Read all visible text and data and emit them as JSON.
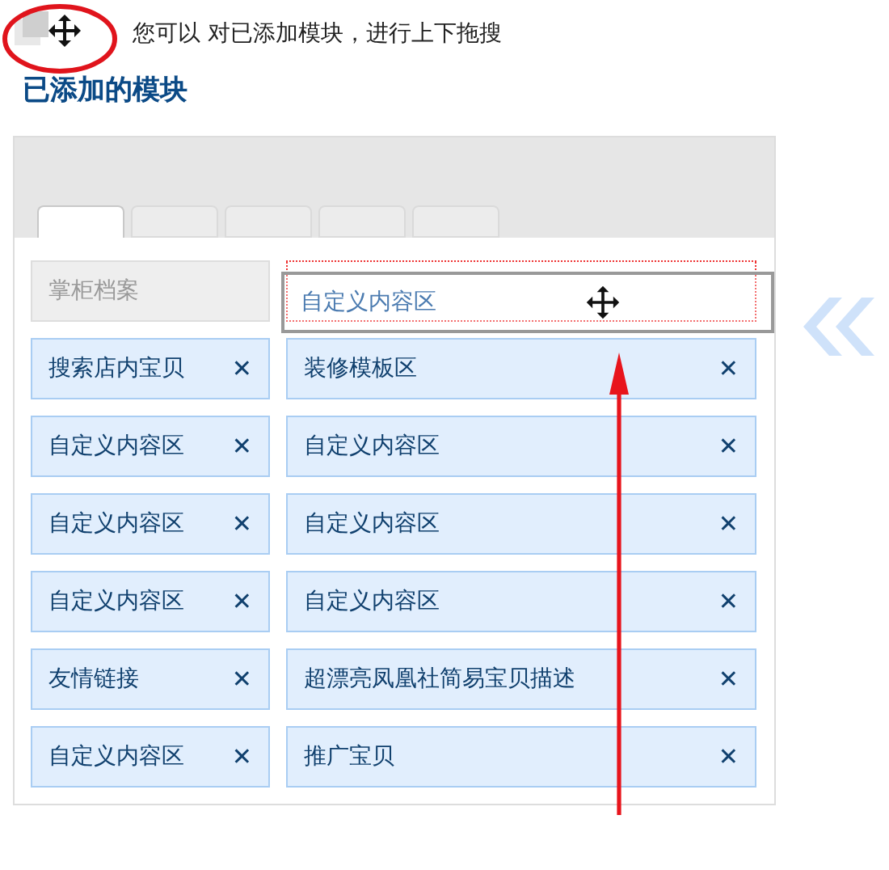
{
  "hint": {
    "text": "您可以 对已添加模块，进行上下拖搜"
  },
  "heading": "已添加的模块",
  "tabs": [
    {
      "selected": true
    },
    {
      "selected": false
    },
    {
      "selected": false
    },
    {
      "selected": false
    },
    {
      "selected": false
    }
  ],
  "columns": [
    {
      "modules": [
        {
          "label": "掌柜档案",
          "kind": "fixed"
        },
        {
          "label": "搜索店内宝贝",
          "kind": "normal",
          "remove": "✕"
        },
        {
          "label": "自定义内容区",
          "kind": "normal",
          "remove": "✕"
        },
        {
          "label": "自定义内容区",
          "kind": "normal",
          "remove": "✕"
        },
        {
          "label": "自定义内容区",
          "kind": "normal",
          "remove": "✕"
        },
        {
          "label": "友情链接",
          "kind": "normal",
          "remove": "✕"
        },
        {
          "label": "自定义内容区",
          "kind": "normal",
          "remove": "✕"
        }
      ]
    },
    {
      "modules": [
        {
          "label": "自定义内容区",
          "kind": "dragging"
        },
        {
          "label": "装修模板区",
          "kind": "normal",
          "remove": "✕"
        },
        {
          "label": "自定义内容区",
          "kind": "normal",
          "remove": "✕"
        },
        {
          "label": "自定义内容区",
          "kind": "normal",
          "remove": "✕"
        },
        {
          "label": "自定义内容区",
          "kind": "normal",
          "remove": "✕"
        },
        {
          "label": "超漂亮凤凰社简易宝贝描述",
          "kind": "normal",
          "remove": "✕"
        },
        {
          "label": "推广宝贝",
          "kind": "normal",
          "remove": "✕"
        }
      ]
    }
  ]
}
